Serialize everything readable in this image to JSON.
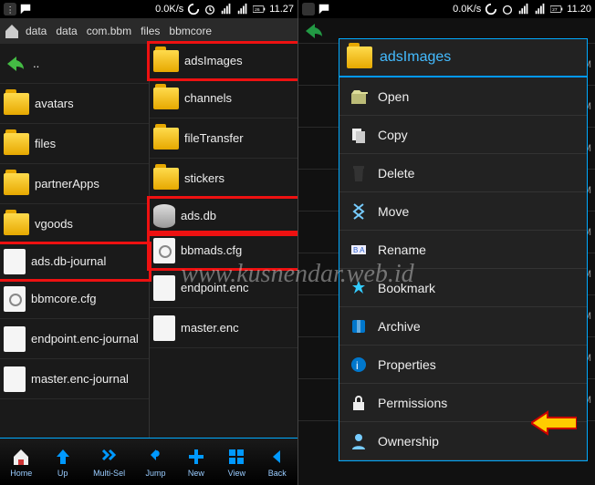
{
  "watermark": "www.kusnendar.web.id",
  "left": {
    "status": {
      "speed": "0.0K/s",
      "time": "11.27",
      "battery": "26"
    },
    "breadcrumb": [
      "data",
      "data",
      "com.bbm",
      "files",
      "bbmcore"
    ],
    "back_label": "..",
    "col1": [
      {
        "icon": "folder",
        "label": "avatars",
        "hl": false
      },
      {
        "icon": "folder",
        "label": "files",
        "hl": false
      },
      {
        "icon": "folder",
        "label": "partnerApps",
        "hl": false
      },
      {
        "icon": "folder",
        "label": "vgoods",
        "hl": false
      },
      {
        "icon": "file",
        "label": "ads.db-journal",
        "hl": true
      },
      {
        "icon": "cfg",
        "label": "bbmcore.cfg",
        "hl": false
      },
      {
        "icon": "file",
        "label": "endpoint.enc-journal",
        "hl": false
      },
      {
        "icon": "file",
        "label": "master.enc-journal",
        "hl": false
      }
    ],
    "col2": [
      {
        "icon": "folder",
        "label": "adsImages",
        "hl": true
      },
      {
        "icon": "folder",
        "label": "channels",
        "hl": false
      },
      {
        "icon": "folder",
        "label": "fileTransfer",
        "hl": false
      },
      {
        "icon": "folder",
        "label": "stickers",
        "hl": false
      },
      {
        "icon": "db",
        "label": "ads.db",
        "hl": true
      },
      {
        "icon": "cfg",
        "label": "bbmads.cfg",
        "hl": true
      },
      {
        "icon": "file",
        "label": "endpoint.enc",
        "hl": false
      },
      {
        "icon": "file",
        "label": "master.enc",
        "hl": false
      }
    ],
    "toolbar": [
      {
        "name": "home",
        "label": "Home"
      },
      {
        "name": "up",
        "label": "Up"
      },
      {
        "name": "multisel",
        "label": "Multi-Sel"
      },
      {
        "name": "jump",
        "label": "Jump"
      },
      {
        "name": "new",
        "label": "New"
      },
      {
        "name": "view",
        "label": "View"
      },
      {
        "name": "back",
        "label": "Back"
      }
    ]
  },
  "right": {
    "status": {
      "speed": "0.0K/s",
      "time": "11.20",
      "battery": "27"
    },
    "title": "adsImages",
    "menu": [
      {
        "icon": "open",
        "label": "Open"
      },
      {
        "icon": "copy",
        "label": "Copy"
      },
      {
        "icon": "delete",
        "label": "Delete"
      },
      {
        "icon": "move",
        "label": "Move"
      },
      {
        "icon": "rename",
        "label": "Rename"
      },
      {
        "icon": "bookmark",
        "label": "Bookmark"
      },
      {
        "icon": "archive",
        "label": "Archive"
      },
      {
        "icon": "properties",
        "label": "Properties"
      },
      {
        "icon": "permissions",
        "label": "Permissions"
      },
      {
        "icon": "ownership",
        "label": "Ownership"
      }
    ],
    "bg_pm": "PM"
  }
}
